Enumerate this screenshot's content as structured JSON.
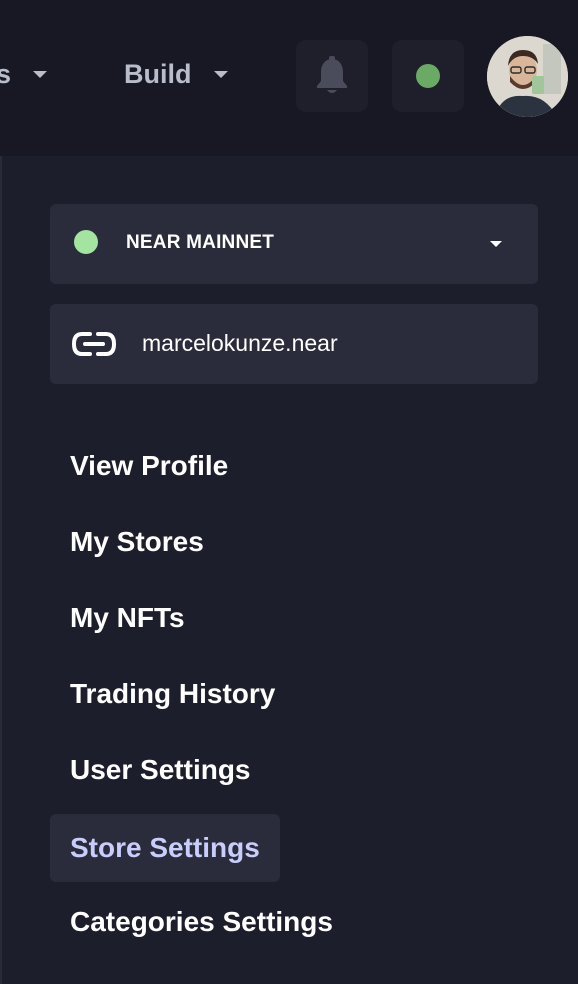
{
  "header": {
    "nav": [
      {
        "label": "s"
      },
      {
        "label": "Build"
      }
    ],
    "status_color": "#6aaa64"
  },
  "network": {
    "label": "NEAR MAINNET",
    "dot_color": "#a3e4a0"
  },
  "account": {
    "name": "marcelokunze.near"
  },
  "menu": {
    "items": [
      {
        "label": "View Profile"
      },
      {
        "label": "My Stores"
      },
      {
        "label": "My NFTs"
      },
      {
        "label": "Trading History"
      },
      {
        "label": "User Settings"
      },
      {
        "label": "Store Settings",
        "active": true
      },
      {
        "label": "Categories Settings"
      }
    ]
  },
  "icons": [
    "chevron-down-icon",
    "bell-icon",
    "status-dot-icon",
    "avatar",
    "link-icon"
  ]
}
